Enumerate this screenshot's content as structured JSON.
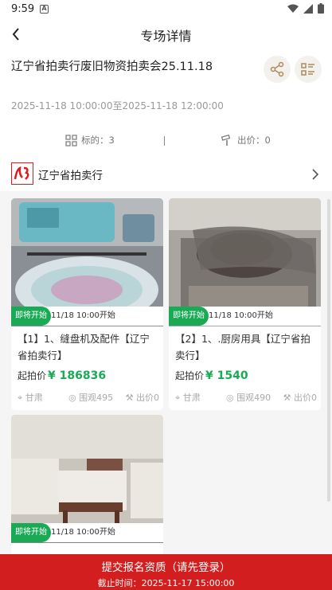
{
  "status_bar": {
    "time": "9:59",
    "notification": "A"
  },
  "nav": {
    "title": "专场详情"
  },
  "auction": {
    "title": "辽宁省拍卖行废旧物资拍卖会25.11.18",
    "time_range": "2025-11-18 10:00:00至2025-11-18 12:00:00",
    "lots_label": "标的：3",
    "bids_label": "出价：0"
  },
  "organizer": {
    "name": "辽宁省拍卖行"
  },
  "lots": [
    {
      "badge": "即将开始",
      "start_time": "11/18 10:00开始",
      "title": "【1】1、缝盘机及配件【辽宁省拍卖行】",
      "price_label": "起拍价",
      "price": "¥ 186836",
      "location": "甘肃",
      "views": "围观495",
      "bids": "出价0"
    },
    {
      "badge": "即将开始",
      "start_time": "11/18 10:00开始",
      "title": "【2】1、.厨房用具【辽宁省拍卖行】",
      "price_label": "起拍价",
      "price": "¥ 1540",
      "location": "甘肃",
      "views": "围观490",
      "bids": "出价0"
    },
    {
      "badge": "即将开始",
      "start_time": "11/18 10:00开始",
      "title": "",
      "price_label": "",
      "price": "",
      "location": "",
      "views": "",
      "bids": ""
    }
  ],
  "footer": {
    "main": "提交报名资质（请先登录）",
    "deadline": "截止时间：2025-11-17 15:00:00"
  },
  "colors": {
    "accent_green": "#1aaa55",
    "footer_red": "#d21e1e"
  }
}
